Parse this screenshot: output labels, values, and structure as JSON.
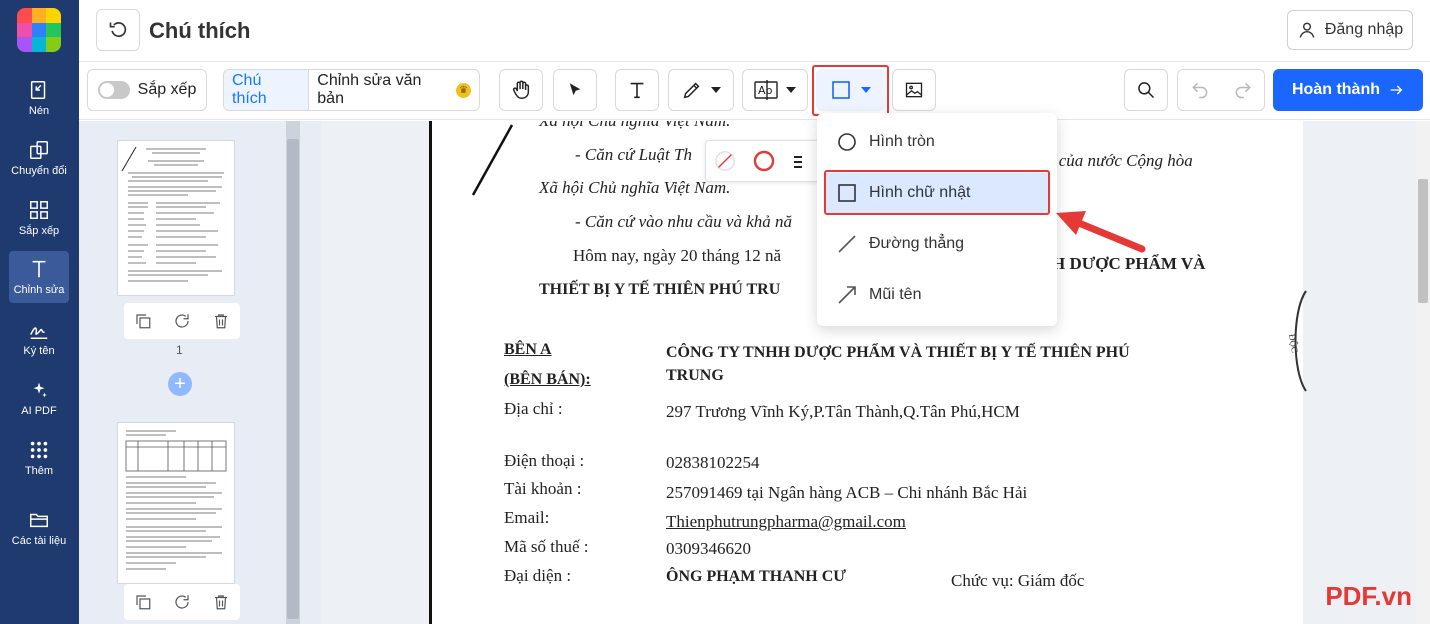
{
  "sidebar": {
    "items": [
      {
        "label": "Nén",
        "icon": "compress-icon"
      },
      {
        "label": "Chuyển đổi",
        "icon": "convert-icon"
      },
      {
        "label": "Sắp xếp",
        "icon": "grid-icon"
      },
      {
        "label": "Chỉnh sửa",
        "icon": "text-edit-icon",
        "active": true
      },
      {
        "label": "Ký tên",
        "icon": "signature-icon"
      },
      {
        "label": "AI PDF",
        "icon": "sparkle-icon"
      },
      {
        "label": "Thêm",
        "icon": "apps-icon"
      },
      {
        "label": "Các tài liệu",
        "icon": "folder-icon"
      }
    ]
  },
  "header": {
    "title": "Chú thích",
    "login_label": "Đăng nhập"
  },
  "toolbar": {
    "arrange_label": "Sắp xếp",
    "tab_annotate": "Chú thích",
    "tab_edit_text": "Chỉnh sửa văn bản",
    "done_label": "Hoàn thành",
    "accent": "#1a66ff",
    "highlight_color": "#e53935"
  },
  "thumbnails": {
    "page_number": "1"
  },
  "shape_menu": {
    "items": [
      {
        "label": "Hình tròn",
        "icon": "circle-icon"
      },
      {
        "label": "Hình chữ nhật",
        "icon": "rectangle-icon",
        "selected": true
      },
      {
        "label": "Đường thẳng",
        "icon": "line-icon"
      },
      {
        "label": "Mũi tên",
        "icon": "arrow-icon"
      }
    ]
  },
  "document": {
    "line1": "Xã hội Chủ nghĩa Việt Nam.",
    "line2": "- Căn cứ Luật Th",
    "line2_right": "5 của nước Cộng hòa",
    "line3": "Xã hội Chủ nghĩa Việt Nam.",
    "line4": "- Căn cứ vào nhu cầu và khả nă",
    "line5": "Hôm nay, ngày 20 tháng 12 nă",
    "line5_right": "H DƯỢC PHẨM VÀ",
    "line6": "THIẾT BỊ Y TẾ THIÊN PHÚ TRU",
    "party_a_label": "BÊN A",
    "party_a_sub": "(BÊN BÁN):",
    "company_name": "CÔNG TY TNHH DƯỢC PHẨM  VÀ THIẾT BỊ Y TẾ THIÊN PHÚ",
    "company_name2": "TRUNG",
    "address_label": "Địa chỉ :",
    "address_value": "297 Trương Vĩnh Ký,P.Tân Thành,Q.Tân Phú,HCM",
    "phone_label": "Điện thoại :",
    "phone_value": "02838102254",
    "account_label": "Tài khoản :",
    "account_value": "257091469 tại Ngân hàng ACB – Chi nhánh Bắc Hải",
    "email_label": "Email:",
    "email_value": "Thienphutrungpharma@gmail.com",
    "tax_label": "Mã số thuế :",
    "tax_value": "0309346620",
    "rep_label": "Đại diện :",
    "rep_value": "ÔNG PHẠM THANH CƯ",
    "position_value": "Chức vụ: Giám đốc"
  },
  "watermark": "PDF.vn"
}
